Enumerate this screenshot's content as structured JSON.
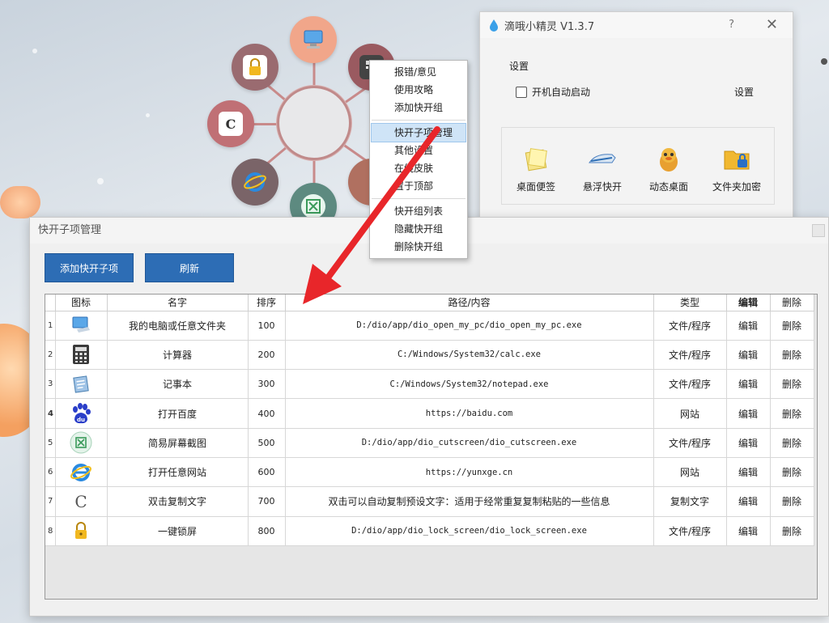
{
  "app_window": {
    "title": "滴哦小精灵 V1.3.7",
    "help": "?",
    "close": "✕",
    "settings_label": "设置",
    "autostart_label": "开机自动启动",
    "settings_button": "设置",
    "tools": [
      {
        "label": "桌面便签",
        "icon": "sticky-note-icon"
      },
      {
        "label": "悬浮快开",
        "icon": "bullet-train-icon"
      },
      {
        "label": "动态桌面",
        "icon": "penguin-icon"
      },
      {
        "label": "文件夹加密",
        "icon": "folder-lock-icon"
      }
    ]
  },
  "context_menu": {
    "items": [
      {
        "label": "报错/意见"
      },
      {
        "label": "使用攻略"
      },
      {
        "label": "添加快开组"
      },
      {
        "label": "快开子项管理",
        "highlighted": true
      },
      {
        "label": "其他设置"
      },
      {
        "label": "在线皮肤"
      },
      {
        "label": "置于顶部"
      },
      {
        "label": "快开组列表"
      },
      {
        "label": "隐藏快开组"
      },
      {
        "label": "删除快开组"
      }
    ]
  },
  "sub_window": {
    "title": "快开子项管理",
    "add_button": "添加快开子项",
    "refresh_button": "刷新",
    "columns": [
      "图标",
      "名字",
      "排序",
      "路径/内容",
      "类型",
      "编辑",
      "删除"
    ],
    "rows": [
      {
        "idx": "1",
        "icon": "computer-icon",
        "name": "我的电脑或任意文件夹",
        "sort": "100",
        "path": "D:/dio/app/dio_open_my_pc/dio_open_my_pc.exe",
        "type": "文件/程序",
        "edit": "编辑",
        "del": "删除"
      },
      {
        "idx": "2",
        "icon": "calculator-icon",
        "name": "计算器",
        "sort": "200",
        "path": "C:/Windows/System32/calc.exe",
        "type": "文件/程序",
        "edit": "编辑",
        "del": "删除"
      },
      {
        "idx": "3",
        "icon": "notepad-icon",
        "name": "记事本",
        "sort": "300",
        "path": "C:/Windows/System32/notepad.exe",
        "type": "文件/程序",
        "edit": "编辑",
        "del": "删除"
      },
      {
        "idx": "4",
        "icon": "baidu-icon",
        "name": "打开百度",
        "sort": "400",
        "path": "https://baidu.com",
        "type": "网站",
        "edit": "编辑",
        "del": "删除"
      },
      {
        "idx": "5",
        "icon": "screenshot-icon",
        "name": "简易屏幕截图",
        "sort": "500",
        "path": "D:/dio/app/dio_cutscreen/dio_cutscreen.exe",
        "type": "文件/程序",
        "edit": "编辑",
        "del": "删除"
      },
      {
        "idx": "6",
        "icon": "ie-browser-icon",
        "name": "打开任意网站",
        "sort": "600",
        "path": "https://yunxge.cn",
        "type": "网站",
        "edit": "编辑",
        "del": "删除"
      },
      {
        "idx": "7",
        "icon": "copy-c-icon",
        "name": "双击复制文字",
        "sort": "700",
        "path": "双击可以自动复制预设文字：适用于经常重复复制粘贴的一些信息",
        "type": "复制文字",
        "edit": "编辑",
        "del": "删除"
      },
      {
        "idx": "8",
        "icon": "lock-icon",
        "name": "一键锁屏",
        "sort": "800",
        "path": "D:/dio/app/dio_lock_screen/dio_lock_screen.exe",
        "type": "文件/程序",
        "edit": "编辑",
        "del": "删除"
      }
    ]
  },
  "colors": {
    "button_blue": "#2d6db5",
    "menu_highlight": "#cfe4f7",
    "arrow_red": "#e8262a"
  }
}
